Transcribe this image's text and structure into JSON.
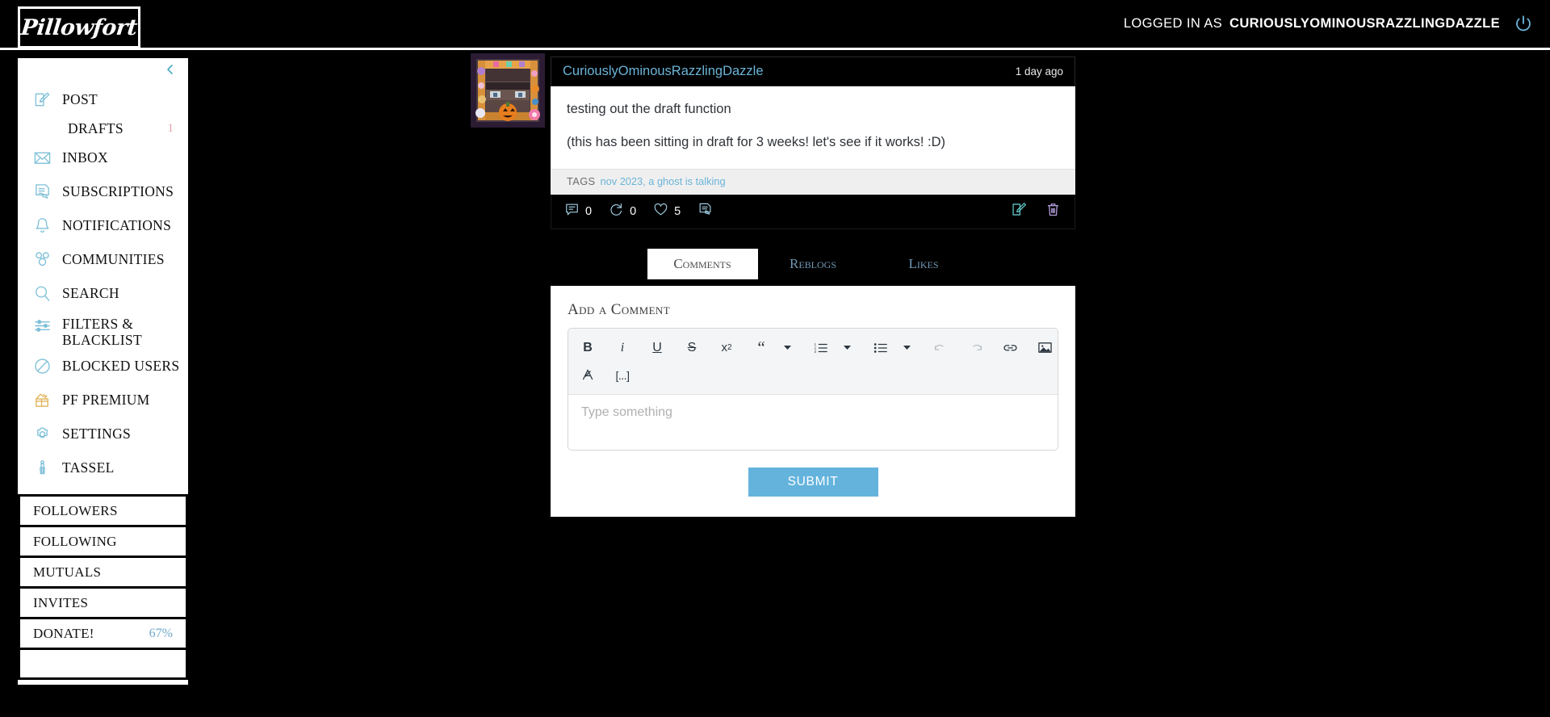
{
  "topbar": {
    "logo": "Pillowfort",
    "logged_in_label": "LOGGED IN AS",
    "username": "CURIOUSLYOMINOUSRAZZLINGDAZZLE",
    "power_icon": "power-icon"
  },
  "sidebar": {
    "collapse_icon": "chevron-left-icon",
    "items": [
      {
        "label": "POST",
        "icon": "compose-icon"
      },
      {
        "label": "DRAFTS",
        "icon": "none",
        "count": "1"
      },
      {
        "label": "INBOX",
        "icon": "envelope-icon"
      },
      {
        "label": "SUBSCRIPTIONS",
        "icon": "subscriptions-icon"
      },
      {
        "label": "NOTIFICATIONS",
        "icon": "bell-icon"
      },
      {
        "label": "COMMUNITIES",
        "icon": "communities-icon"
      },
      {
        "label": "SEARCH",
        "icon": "search-icon"
      },
      {
        "label": "FILTERS & BLACKLIST",
        "icon": "sliders-icon"
      },
      {
        "label": "BLOCKED USERS",
        "icon": "block-icon"
      },
      {
        "label": "PF PREMIUM",
        "icon": "gift-icon"
      },
      {
        "label": "SETTINGS",
        "icon": "gear-icon"
      },
      {
        "label": "TASSEL",
        "icon": "tassel-icon"
      }
    ],
    "boxed_items": [
      {
        "label": "FOLLOWERS",
        "extra": ""
      },
      {
        "label": "FOLLOWING",
        "extra": ""
      },
      {
        "label": "MUTUALS",
        "extra": ""
      },
      {
        "label": "INVITES",
        "extra": ""
      },
      {
        "label": "DONATE!",
        "extra": "67%"
      }
    ]
  },
  "post": {
    "author": "CuriouslyOminousRazzlingDazzle",
    "timestamp": "1 day ago",
    "avatar_icon": "user-avatar",
    "paragraphs": [
      "testing out the draft function",
      "(this has been sitting in draft for 3 weeks! let's see if it works! :D)"
    ],
    "tags_label": "TAGS",
    "tags": "nov 2023, a ghost is talking",
    "actions": {
      "comment_icon": "comment-icon",
      "comment_count": "0",
      "reblog_icon": "reblog-icon",
      "reblog_count": "0",
      "like_icon": "heart-icon",
      "like_count": "5",
      "share_icon": "share-icon",
      "edit_icon": "edit-icon",
      "delete_icon": "trash-icon"
    }
  },
  "tabs": [
    {
      "label": "Comments",
      "active": true
    },
    {
      "label": "Reblogs",
      "active": false
    },
    {
      "label": "Likes",
      "active": false
    }
  ],
  "comment_form": {
    "title": "Add a Comment",
    "placeholder": "Type something",
    "submit_label": "SUBMIT",
    "toolbar_row1": [
      {
        "name": "bold-icon",
        "glyph": "B"
      },
      {
        "name": "italic-icon",
        "glyph": "i"
      },
      {
        "name": "underline-icon",
        "glyph": "U"
      },
      {
        "name": "strikethrough-icon",
        "glyph": "S"
      },
      {
        "name": "subscript-icon",
        "glyph": "x"
      },
      {
        "name": "blockquote-icon",
        "glyph": "“"
      },
      {
        "name": "ordered-list-icon",
        "glyph": ""
      },
      {
        "name": "bullet-list-icon",
        "glyph": ""
      },
      {
        "name": "undo-icon",
        "glyph": ""
      },
      {
        "name": "redo-icon",
        "glyph": ""
      },
      {
        "name": "link-icon",
        "glyph": ""
      },
      {
        "name": "image-icon",
        "glyph": ""
      },
      {
        "name": "horizontal-rule-icon",
        "glyph": "—"
      }
    ],
    "toolbar_row2": [
      {
        "name": "clear-format-icon",
        "glyph": "Ꞣ"
      },
      {
        "name": "more-options-icon",
        "glyph": "[...]"
      }
    ]
  },
  "colors": {
    "accent_blue": "#6bb4d8",
    "submit_blue": "#63b3dd",
    "edit_teal": "#5fc2c2",
    "delete_purple": "#b39ddb",
    "badge_pink": "#e8a0a8"
  }
}
